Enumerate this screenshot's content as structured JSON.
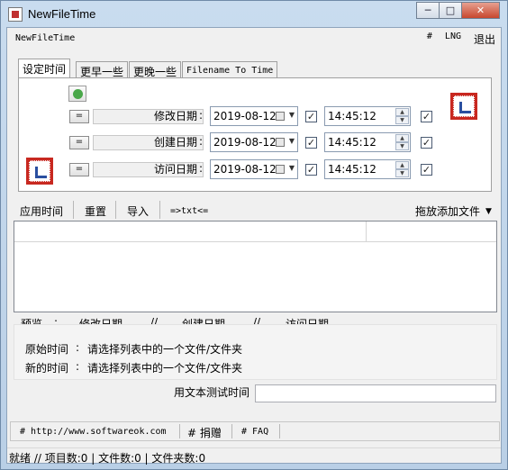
{
  "window": {
    "title": "NewFileTime",
    "minimize_glyph": "─",
    "maximize_glyph": "□",
    "close_glyph": "✕"
  },
  "menu": {
    "app_name": "NewFileTime",
    "hash": "#",
    "lng": "LNG",
    "exit": "退出"
  },
  "tabs": [
    {
      "label": "设定时间",
      "active": true
    },
    {
      "label": "更早一些",
      "active": false
    },
    {
      "label": "更晚一些",
      "active": false
    },
    {
      "label": "Filename To Time",
      "active": false
    }
  ],
  "date_rows": [
    {
      "eq": "=",
      "label": "修改日期",
      "colon": ":",
      "date": "2019-08-12",
      "date_checked": true,
      "time": "14:45:12",
      "time_checked": true
    },
    {
      "eq": "=",
      "label": "创建日期",
      "colon": ":",
      "date": "2019-08-12",
      "date_checked": true,
      "time": "14:45:12",
      "time_checked": true
    },
    {
      "eq": "=",
      "label": "访问日期",
      "colon": ":",
      "date": "2019-08-12",
      "date_checked": true,
      "time": "14:45:12",
      "time_checked": true
    }
  ],
  "toolbar": {
    "apply": "应用时间",
    "reset": "重置",
    "import": "导入",
    "txt": "=>txt<=",
    "drag_add": "拖放添加文件",
    "drag_arrow": "▼"
  },
  "preview": {
    "label": "预览",
    "colon": ":",
    "modified": "修改日期",
    "sep1": "//",
    "created": "创建日期",
    "sep2": "//",
    "accessed": "访问日期"
  },
  "info": {
    "original_label": "原始时间",
    "original_value": "请选择列表中的一个文件/文件夹",
    "new_label": "新的时间",
    "new_value": "请选择列表中的一个文件/文件夹",
    "colon": ":"
  },
  "text_test": {
    "label": "用文本测试时间",
    "value": ""
  },
  "links": {
    "website": "# http://www.softwareok.com",
    "donate": "# 捐赠",
    "faq": "# FAQ"
  },
  "status": {
    "text": "就绪 // 项目数:0 | 文件数:0 | 文件夹数:0"
  },
  "colors": {
    "accent_red": "#c82820",
    "close_button": "#c8472e",
    "titlebar": "#c9dcef"
  }
}
